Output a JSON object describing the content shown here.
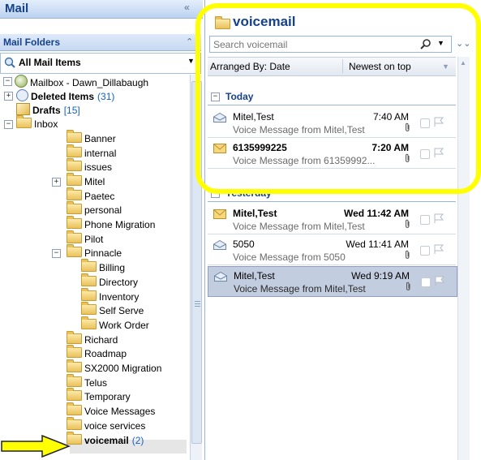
{
  "nav": {
    "title": "Mail",
    "collapse_glyph": "«",
    "folders_title": "Mail Folders",
    "folders_glyph": "⌃",
    "all_mail": "All Mail Items",
    "tree": [
      {
        "label": "Mailbox - Dawn_Dillabaugh",
        "count": "",
        "bold": false,
        "icon": "mailbox-icon",
        "expander": "−",
        "level": 0
      },
      {
        "label": "Deleted Items",
        "count": "(31)",
        "bold": true,
        "icon": "deleted-items-icon",
        "expander": "+",
        "level": 1
      },
      {
        "label": "Drafts",
        "count": "[15]",
        "bold": true,
        "icon": "drafts-icon",
        "expander": "",
        "level": 1
      },
      {
        "label": "Inbox",
        "count": "",
        "bold": false,
        "icon": "inbox-icon",
        "expander": "−",
        "level": 1
      },
      {
        "label": "Banner",
        "count": "",
        "bold": false,
        "icon": "folder-icon",
        "expander": "",
        "level": 2
      },
      {
        "label": "internal",
        "count": "",
        "bold": false,
        "icon": "folder-icon",
        "expander": "",
        "level": 2
      },
      {
        "label": "issues",
        "count": "",
        "bold": false,
        "icon": "folder-icon",
        "expander": "",
        "level": 2
      },
      {
        "label": "Mitel",
        "count": "",
        "bold": false,
        "icon": "folder-icon",
        "expander": "+",
        "level": 2
      },
      {
        "label": "Paetec",
        "count": "",
        "bold": false,
        "icon": "folder-icon",
        "expander": "",
        "level": 2
      },
      {
        "label": "personal",
        "count": "",
        "bold": false,
        "icon": "folder-icon",
        "expander": "",
        "level": 2
      },
      {
        "label": "Phone Migration",
        "count": "",
        "bold": false,
        "icon": "folder-icon",
        "expander": "",
        "level": 2
      },
      {
        "label": "Pilot",
        "count": "",
        "bold": false,
        "icon": "folder-icon",
        "expander": "",
        "level": 2
      },
      {
        "label": "Pinnacle",
        "count": "",
        "bold": false,
        "icon": "folder-icon",
        "expander": "−",
        "level": 2
      },
      {
        "label": "Billing",
        "count": "",
        "bold": false,
        "icon": "folder-icon",
        "expander": "",
        "level": 3
      },
      {
        "label": "Directory",
        "count": "",
        "bold": false,
        "icon": "folder-icon",
        "expander": "",
        "level": 3
      },
      {
        "label": "Inventory",
        "count": "",
        "bold": false,
        "icon": "folder-icon",
        "expander": "",
        "level": 3
      },
      {
        "label": "Self Serve",
        "count": "",
        "bold": false,
        "icon": "folder-icon",
        "expander": "",
        "level": 3
      },
      {
        "label": "Work Order",
        "count": "",
        "bold": false,
        "icon": "folder-icon",
        "expander": "",
        "level": 3
      },
      {
        "label": "Richard",
        "count": "",
        "bold": false,
        "icon": "folder-icon",
        "expander": "",
        "level": 2
      },
      {
        "label": "Roadmap",
        "count": "",
        "bold": false,
        "icon": "folder-icon",
        "expander": "",
        "level": 2
      },
      {
        "label": "SX2000 Migration",
        "count": "",
        "bold": false,
        "icon": "folder-icon",
        "expander": "",
        "level": 2
      },
      {
        "label": "Telus",
        "count": "",
        "bold": false,
        "icon": "folder-icon",
        "expander": "",
        "level": 2
      },
      {
        "label": "Temporary",
        "count": "",
        "bold": false,
        "icon": "folder-icon",
        "expander": "",
        "level": 2
      },
      {
        "label": "Voice Messages",
        "count": "",
        "bold": false,
        "icon": "folder-icon",
        "expander": "",
        "level": 2
      },
      {
        "label": "voice services",
        "count": "",
        "bold": false,
        "icon": "folder-icon",
        "expander": "",
        "level": 2
      },
      {
        "label": "voicemail",
        "count": "(2)",
        "bold": true,
        "icon": "folder-icon",
        "expander": "",
        "level": 2
      }
    ]
  },
  "list": {
    "title": "voicemail",
    "search_placeholder": "Search voicemail",
    "arranged_by": "Arranged By: Date",
    "sort_order": "Newest on top",
    "groups": [
      {
        "label": "Today",
        "messages": [
          {
            "sender": "Mitel,Test",
            "time": "7:40 AM",
            "subject": "Voice Message from Mitel,Test",
            "unread": false,
            "selected": false,
            "icon": "opened-envelope-icon"
          },
          {
            "sender": "6135999225",
            "time": "7:20 AM",
            "subject": "Voice Message from 61359992...",
            "unread": true,
            "selected": false,
            "icon": "unread-envelope-icon"
          }
        ]
      },
      {
        "label": "Yesterday",
        "messages": [
          {
            "sender": "Mitel,Test",
            "time": "Wed 11:42 AM",
            "subject": "Voice Message from Mitel,Test",
            "unread": true,
            "selected": false,
            "icon": "unread-envelope-icon"
          },
          {
            "sender": "5050",
            "time": "Wed 11:41 AM",
            "subject": "Voice Message from 5050",
            "unread": false,
            "selected": false,
            "icon": "opened-envelope-icon"
          },
          {
            "sender": "Mitel,Test",
            "time": "Wed 9:19 AM",
            "subject": "Voice Message from Mitel,Test",
            "unread": false,
            "selected": true,
            "icon": "opened-envelope-icon"
          }
        ]
      }
    ]
  },
  "colors": {
    "highlight": "#ffff00",
    "header_text": "#15428b",
    "count_blue": "#1560c6",
    "selected_row": "#c3cde0"
  }
}
